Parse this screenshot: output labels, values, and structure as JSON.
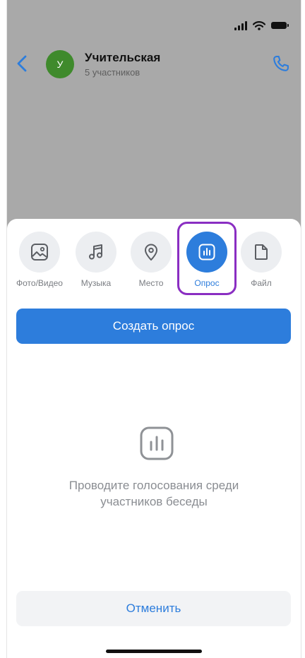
{
  "header": {
    "avatar_letter": "У",
    "title": "Учительская",
    "subtitle": "5 участников"
  },
  "attachments": [
    {
      "label": "Фото/Видео",
      "icon": "photo-icon"
    },
    {
      "label": "Музыка",
      "icon": "music-icon"
    },
    {
      "label": "Место",
      "icon": "location-pin-icon"
    },
    {
      "label": "Опрос",
      "icon": "poll-icon",
      "selected": true
    },
    {
      "label": "Файл",
      "icon": "file-icon"
    }
  ],
  "create_button": "Создать опрос",
  "empty_state": {
    "line1": "Проводите голосования среди",
    "line2": "участников беседы"
  },
  "cancel_button": "Отменить",
  "colors": {
    "accent": "#2d7ddc",
    "highlight": "#8a2ec2",
    "avatar": "#3f8a2c",
    "dim_overlay": "#a9a9a9"
  }
}
